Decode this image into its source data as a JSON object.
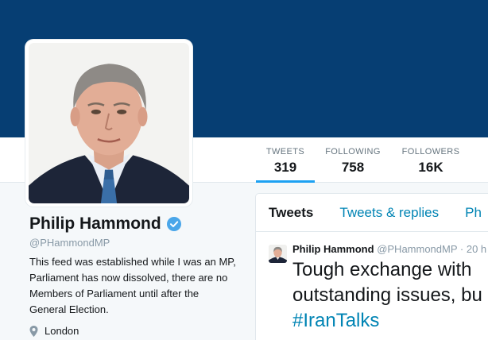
{
  "colors": {
    "banner": "#063e73",
    "accent": "#1da1f2",
    "link": "#0084b4"
  },
  "stats": [
    {
      "label": "TWEETS",
      "value": "319"
    },
    {
      "label": "FOLLOWING",
      "value": "758"
    },
    {
      "label": "FOLLOWERS",
      "value": "16K"
    }
  ],
  "profile": {
    "name": "Philip Hammond",
    "verified_icon": "verified-badge-icon",
    "handle": "@PHammondMP",
    "bio": "This feed was established while I was an MP, Parliament has now dissolved, there are no Members of Parliament until after the General Election.",
    "location": "London",
    "location_icon": "map-pin-icon"
  },
  "timeline": {
    "tabs": [
      "Tweets",
      "Tweets & replies",
      "Ph"
    ],
    "active_tab": "Tweets"
  },
  "tweet": {
    "author": "Philip Hammond",
    "handle": "@PHammondMP",
    "time": "· 20 h",
    "text_line1": "Tough exchange with",
    "text_line2": "outstanding issues, bu",
    "hashtag": "#IranTalks"
  }
}
